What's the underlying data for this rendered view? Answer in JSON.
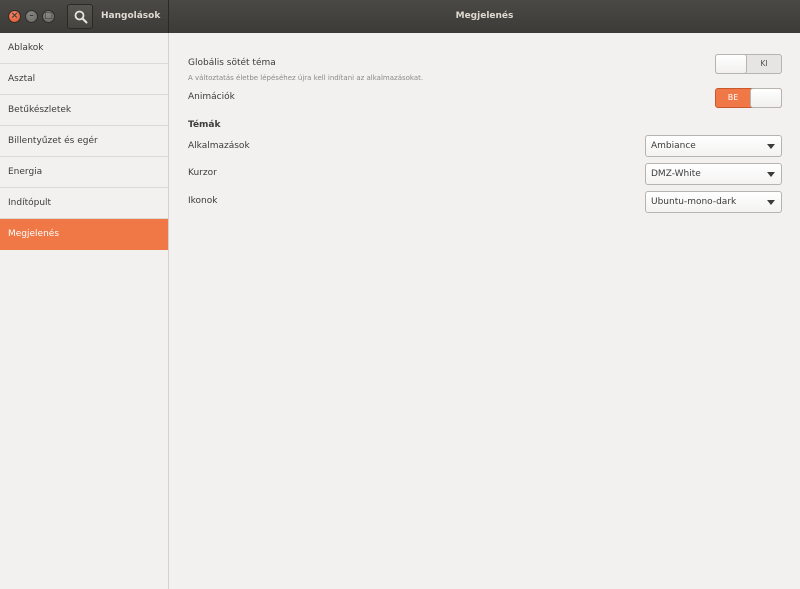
{
  "titlebar": {
    "app_title": "Hangolások",
    "page_title": "Megjelenés"
  },
  "sidebar": {
    "items": [
      {
        "label": "Ablakok"
      },
      {
        "label": "Asztal"
      },
      {
        "label": "Betűkészletek"
      },
      {
        "label": "Billentyűzet és egér"
      },
      {
        "label": "Energia"
      },
      {
        "label": "Indítópult"
      },
      {
        "label": "Megjelenés",
        "active": true
      }
    ]
  },
  "appearance": {
    "dark_theme_label": "Globális sötét téma",
    "dark_theme_hint": "A változtatás életbe lépéséhez újra kell indítani az alkalmazásokat.",
    "dark_theme_state": "KI",
    "animations_label": "Animációk",
    "animations_state": "BE",
    "themes_header": "Témák",
    "apps_label": "Alkalmazások",
    "apps_value": "Ambiance",
    "cursor_label": "Kurzor",
    "cursor_value": "DMZ-White",
    "icons_label": "Ikonok",
    "icons_value": "Ubuntu-mono-dark"
  },
  "colors": {
    "accent": "#f07746",
    "titlebar": "#3c3b37",
    "background": "#f2f1f0"
  }
}
